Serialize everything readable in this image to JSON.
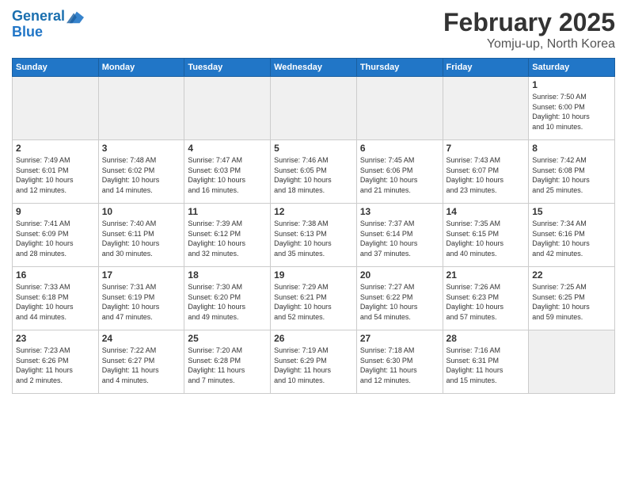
{
  "header": {
    "logo_line1": "General",
    "logo_line2": "Blue",
    "month": "February 2025",
    "location": "Yomju-up, North Korea"
  },
  "weekdays": [
    "Sunday",
    "Monday",
    "Tuesday",
    "Wednesday",
    "Thursday",
    "Friday",
    "Saturday"
  ],
  "weeks": [
    [
      {
        "num": "",
        "info": ""
      },
      {
        "num": "",
        "info": ""
      },
      {
        "num": "",
        "info": ""
      },
      {
        "num": "",
        "info": ""
      },
      {
        "num": "",
        "info": ""
      },
      {
        "num": "",
        "info": ""
      },
      {
        "num": "1",
        "info": "Sunrise: 7:50 AM\nSunset: 6:00 PM\nDaylight: 10 hours\nand 10 minutes."
      }
    ],
    [
      {
        "num": "2",
        "info": "Sunrise: 7:49 AM\nSunset: 6:01 PM\nDaylight: 10 hours\nand 12 minutes."
      },
      {
        "num": "3",
        "info": "Sunrise: 7:48 AM\nSunset: 6:02 PM\nDaylight: 10 hours\nand 14 minutes."
      },
      {
        "num": "4",
        "info": "Sunrise: 7:47 AM\nSunset: 6:03 PM\nDaylight: 10 hours\nand 16 minutes."
      },
      {
        "num": "5",
        "info": "Sunrise: 7:46 AM\nSunset: 6:05 PM\nDaylight: 10 hours\nand 18 minutes."
      },
      {
        "num": "6",
        "info": "Sunrise: 7:45 AM\nSunset: 6:06 PM\nDaylight: 10 hours\nand 21 minutes."
      },
      {
        "num": "7",
        "info": "Sunrise: 7:43 AM\nSunset: 6:07 PM\nDaylight: 10 hours\nand 23 minutes."
      },
      {
        "num": "8",
        "info": "Sunrise: 7:42 AM\nSunset: 6:08 PM\nDaylight: 10 hours\nand 25 minutes."
      }
    ],
    [
      {
        "num": "9",
        "info": "Sunrise: 7:41 AM\nSunset: 6:09 PM\nDaylight: 10 hours\nand 28 minutes."
      },
      {
        "num": "10",
        "info": "Sunrise: 7:40 AM\nSunset: 6:11 PM\nDaylight: 10 hours\nand 30 minutes."
      },
      {
        "num": "11",
        "info": "Sunrise: 7:39 AM\nSunset: 6:12 PM\nDaylight: 10 hours\nand 32 minutes."
      },
      {
        "num": "12",
        "info": "Sunrise: 7:38 AM\nSunset: 6:13 PM\nDaylight: 10 hours\nand 35 minutes."
      },
      {
        "num": "13",
        "info": "Sunrise: 7:37 AM\nSunset: 6:14 PM\nDaylight: 10 hours\nand 37 minutes."
      },
      {
        "num": "14",
        "info": "Sunrise: 7:35 AM\nSunset: 6:15 PM\nDaylight: 10 hours\nand 40 minutes."
      },
      {
        "num": "15",
        "info": "Sunrise: 7:34 AM\nSunset: 6:16 PM\nDaylight: 10 hours\nand 42 minutes."
      }
    ],
    [
      {
        "num": "16",
        "info": "Sunrise: 7:33 AM\nSunset: 6:18 PM\nDaylight: 10 hours\nand 44 minutes."
      },
      {
        "num": "17",
        "info": "Sunrise: 7:31 AM\nSunset: 6:19 PM\nDaylight: 10 hours\nand 47 minutes."
      },
      {
        "num": "18",
        "info": "Sunrise: 7:30 AM\nSunset: 6:20 PM\nDaylight: 10 hours\nand 49 minutes."
      },
      {
        "num": "19",
        "info": "Sunrise: 7:29 AM\nSunset: 6:21 PM\nDaylight: 10 hours\nand 52 minutes."
      },
      {
        "num": "20",
        "info": "Sunrise: 7:27 AM\nSunset: 6:22 PM\nDaylight: 10 hours\nand 54 minutes."
      },
      {
        "num": "21",
        "info": "Sunrise: 7:26 AM\nSunset: 6:23 PM\nDaylight: 10 hours\nand 57 minutes."
      },
      {
        "num": "22",
        "info": "Sunrise: 7:25 AM\nSunset: 6:25 PM\nDaylight: 10 hours\nand 59 minutes."
      }
    ],
    [
      {
        "num": "23",
        "info": "Sunrise: 7:23 AM\nSunset: 6:26 PM\nDaylight: 11 hours\nand 2 minutes."
      },
      {
        "num": "24",
        "info": "Sunrise: 7:22 AM\nSunset: 6:27 PM\nDaylight: 11 hours\nand 4 minutes."
      },
      {
        "num": "25",
        "info": "Sunrise: 7:20 AM\nSunset: 6:28 PM\nDaylight: 11 hours\nand 7 minutes."
      },
      {
        "num": "26",
        "info": "Sunrise: 7:19 AM\nSunset: 6:29 PM\nDaylight: 11 hours\nand 10 minutes."
      },
      {
        "num": "27",
        "info": "Sunrise: 7:18 AM\nSunset: 6:30 PM\nDaylight: 11 hours\nand 12 minutes."
      },
      {
        "num": "28",
        "info": "Sunrise: 7:16 AM\nSunset: 6:31 PM\nDaylight: 11 hours\nand 15 minutes."
      },
      {
        "num": "",
        "info": ""
      }
    ]
  ]
}
